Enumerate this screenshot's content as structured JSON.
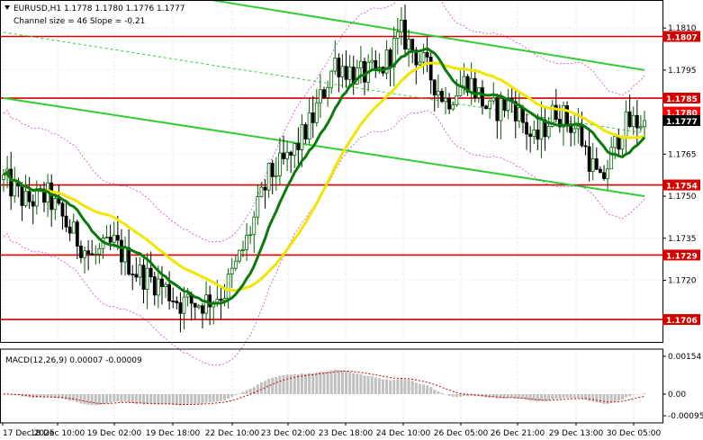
{
  "header": {
    "symbol_line": "EURUSD,H1  1.1778 1.1780 1.1776 1.1777",
    "channel_line": "Channel size = 46 Slope = -0.21"
  },
  "macd": {
    "label": "MACD(12,26,9) 0.00007 -0.00009",
    "ticks": [
      "0.00154",
      "0.00",
      "-0.00095"
    ]
  },
  "colors": {
    "bull": "#006400",
    "bear": "#000000",
    "sma_fast": "#0a7a0a",
    "sma_slow": "#f2e600",
    "channel": "#33cc33",
    "envelope": "#b000b0",
    "level": "#d40000",
    "price_tag": "#ff0000",
    "current_tag": "#000000",
    "macd_hist": "#c0c0c0",
    "macd_signal": "#cc0000"
  },
  "chart_data": {
    "type": "candlestick",
    "symbol": "EURUSD",
    "timeframe": "H1",
    "ohlc_current": {
      "open": 1.1778,
      "high": 1.178,
      "low": 1.1776,
      "close": 1.1777
    },
    "y_axis": {
      "ticks": [
        1.181,
        1.1795,
        1.1765,
        1.175,
        1.1735,
        1.172
      ],
      "ylim": [
        1.1698,
        1.182
      ]
    },
    "x_axis": {
      "labels": [
        "17 Dec 2025",
        "18 Dec 10:00",
        "19 Dec 02:00",
        "19 Dec 18:00",
        "22 Dec 10:00",
        "23 Dec 02:00",
        "23 Dec 18:00",
        "24 Dec 10:00",
        "26 Dec 05:00",
        "26 Dec 21:00",
        "29 Dec 13:00",
        "30 Dec 05:00"
      ]
    },
    "bars": 175,
    "levels": [
      {
        "value": 1.1807,
        "label": "1.1807"
      },
      {
        "value": 1.1785,
        "label": "1.1785"
      },
      {
        "value": 1.1754,
        "label": "1.1754"
      },
      {
        "value": 1.1729,
        "label": "1.1729"
      },
      {
        "value": 1.1706,
        "label": "1.1706"
      }
    ],
    "price_tags": [
      {
        "value": 1.178,
        "label": "1.1780"
      },
      {
        "value": 1.1777,
        "label": "1.1777"
      }
    ],
    "channel": {
      "upper": [
        {
          "bar": 0,
          "price": 1.1832
        },
        {
          "bar": 174,
          "price": 1.1795
        }
      ],
      "lower": [
        {
          "bar": 0,
          "price": 1.1785
        },
        {
          "bar": 174,
          "price": 1.175
        }
      ]
    },
    "close_path": [
      [
        0,
        1.1756
      ],
      [
        6,
        1.1748
      ],
      [
        12,
        1.175
      ],
      [
        18,
        1.1738
      ],
      [
        24,
        1.1728
      ],
      [
        30,
        1.1733
      ],
      [
        36,
        1.1723
      ],
      [
        42,
        1.1719
      ],
      [
        48,
        1.1712
      ],
      [
        54,
        1.1712
      ],
      [
        60,
        1.1716
      ],
      [
        66,
        1.1734
      ],
      [
        72,
        1.1757
      ],
      [
        78,
        1.1764
      ],
      [
        84,
        1.1778
      ],
      [
        90,
        1.1798
      ],
      [
        96,
        1.1793
      ],
      [
        102,
        1.1794
      ],
      [
        108,
        1.1808
      ],
      [
        114,
        1.1797
      ],
      [
        120,
        1.1784
      ],
      [
        126,
        1.1792
      ],
      [
        132,
        1.178
      ],
      [
        138,
        1.1784
      ],
      [
        144,
        1.1769
      ],
      [
        150,
        1.1781
      ],
      [
        156,
        1.1773
      ],
      [
        162,
        1.1754
      ],
      [
        168,
        1.1775
      ],
      [
        174,
        1.1777
      ]
    ]
  }
}
